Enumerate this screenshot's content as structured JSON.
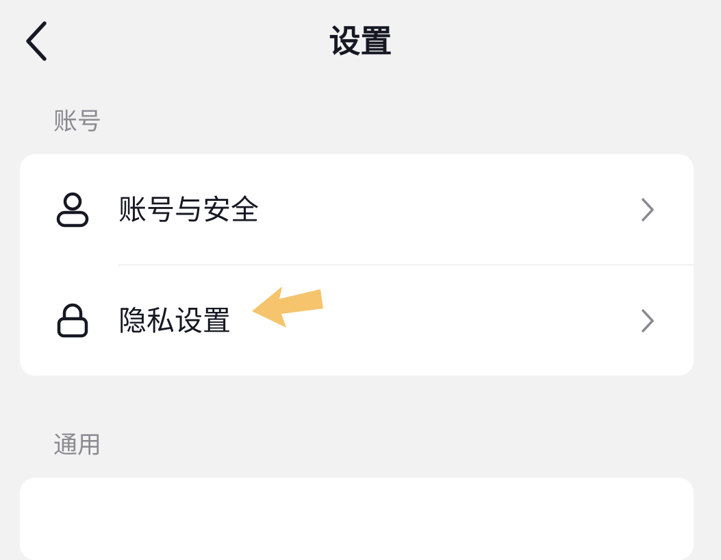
{
  "nav": {
    "title": "设置",
    "back_icon": "chevron-left-icon"
  },
  "sections": [
    {
      "title": "账号",
      "items": [
        {
          "label": "账号与安全",
          "icon": "user-icon"
        },
        {
          "label": "隐私设置",
          "icon": "lock-icon"
        }
      ]
    },
    {
      "title": "通用",
      "items": []
    }
  ],
  "colors": {
    "background": "#f2f2f2",
    "card": "#ffffff",
    "text_primary": "#161823",
    "text_secondary": "#8a8b91",
    "chevron": "#8a8b91",
    "divider": "#e3e3e5",
    "annotation_arrow": "#f5c46c"
  }
}
